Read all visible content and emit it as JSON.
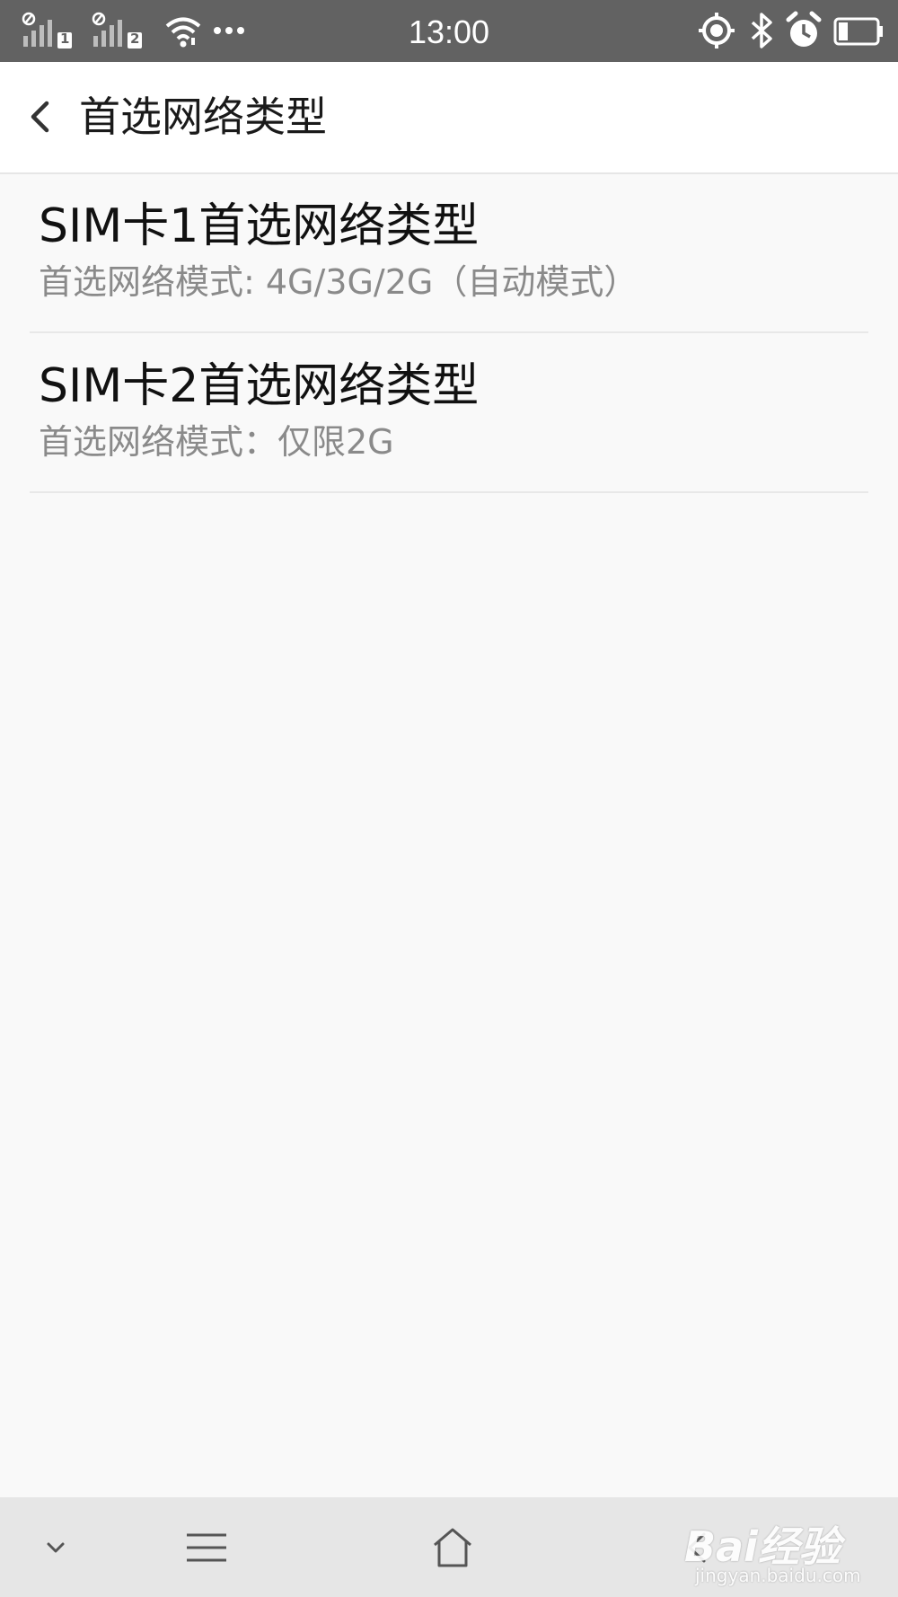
{
  "status_bar": {
    "time": "13:00",
    "sim1_label": "1",
    "sim2_label": "2",
    "icons": [
      "no-sim-signal-icon",
      "no-sim-signal-icon",
      "wifi-icon",
      "more-dots-icon",
      "location-icon",
      "bluetooth-icon",
      "alarm-icon",
      "battery-icon"
    ]
  },
  "app_bar": {
    "title": "首选网络类型",
    "back_icon": "chevron-left-icon"
  },
  "items": [
    {
      "title": "SIM卡1首选网络类型",
      "summary": "首选网络模式: 4G/3G/2G（自动模式）"
    },
    {
      "title": "SIM卡2首选网络类型",
      "summary": "首选网络模式：仅限2G"
    }
  ],
  "nav_bar": {
    "icons": [
      "chevron-down-icon",
      "menu-icon",
      "home-icon",
      "back-icon"
    ]
  },
  "watermark": {
    "brand": "Bai经验",
    "url": "jingyan.baidu.com"
  },
  "colors": {
    "status_bar": "#626262",
    "app_bar": "#ffffff",
    "background": "#f9f9f9",
    "nav_bar": "#e6e6e6",
    "title_text": "#111111",
    "summary_text": "#8a8a8a"
  }
}
